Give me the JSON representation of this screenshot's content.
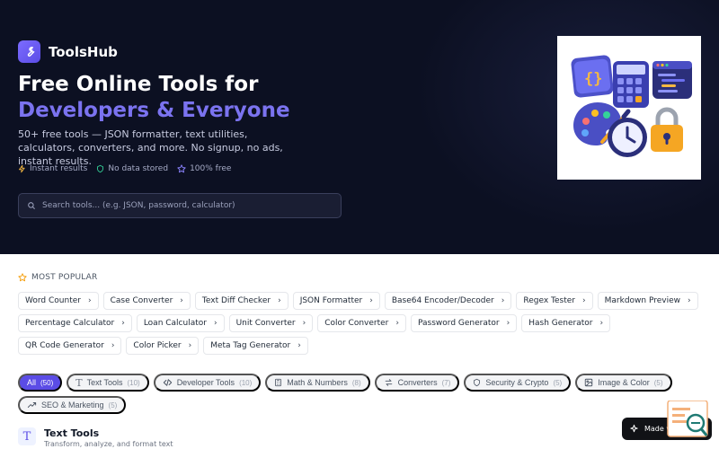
{
  "brand": {
    "name": "ToolsHub"
  },
  "hero": {
    "title_line1": "Free Online Tools for",
    "title_line2": "Developers & Everyone",
    "description": "50+ free tools — JSON formatter, text utilities, calculators, converters, and more. No signup, no ads, instant results.",
    "badges": [
      {
        "icon": "lightning-icon",
        "label": "Instant results",
        "color": "#f5b942"
      },
      {
        "icon": "shield-icon",
        "label": "No data stored",
        "color": "#34d399"
      },
      {
        "icon": "star-icon",
        "label": "100% free",
        "color": "#8b83ff"
      }
    ],
    "search_placeholder": "Search tools... (e.g. JSON, password, calculator)"
  },
  "popular": {
    "heading": "MOST POPULAR",
    "items": [
      "Word Counter",
      "Case Converter",
      "Text Diff Checker",
      "JSON Formatter",
      "Base64 Encoder/Decoder",
      "Regex Tester",
      "Markdown Preview",
      "Percentage Calculator",
      "Loan Calculator",
      "Unit Converter",
      "Color Converter",
      "Password Generator",
      "Hash Generator",
      "QR Code Generator",
      "Color Picker",
      "Meta Tag Generator"
    ]
  },
  "categories": [
    {
      "icon": "",
      "label": "All",
      "count": "(50)",
      "active": true
    },
    {
      "icon": "text-icon",
      "label": "Text Tools",
      "count": "(10)"
    },
    {
      "icon": "code-icon",
      "label": "Developer Tools",
      "count": "(10)"
    },
    {
      "icon": "calculator-icon",
      "label": "Math & Numbers",
      "count": "(8)"
    },
    {
      "icon": "arrows-icon",
      "label": "Converters",
      "count": "(7)"
    },
    {
      "icon": "shield-icon",
      "label": "Security & Crypto",
      "count": "(5)"
    },
    {
      "icon": "image-icon",
      "label": "Image & Color",
      "count": "(5)"
    },
    {
      "icon": "trend-icon",
      "label": "SEO & Marketing",
      "count": "(5)"
    }
  ],
  "section": {
    "title": "Text Tools",
    "subtitle": "Transform, analyze, and format text"
  },
  "made_with": {
    "label": "Made with"
  },
  "colors": {
    "hero_bg": "#0c1022",
    "accent": "#5b4ce6",
    "accent_text": "#7b73f0"
  }
}
